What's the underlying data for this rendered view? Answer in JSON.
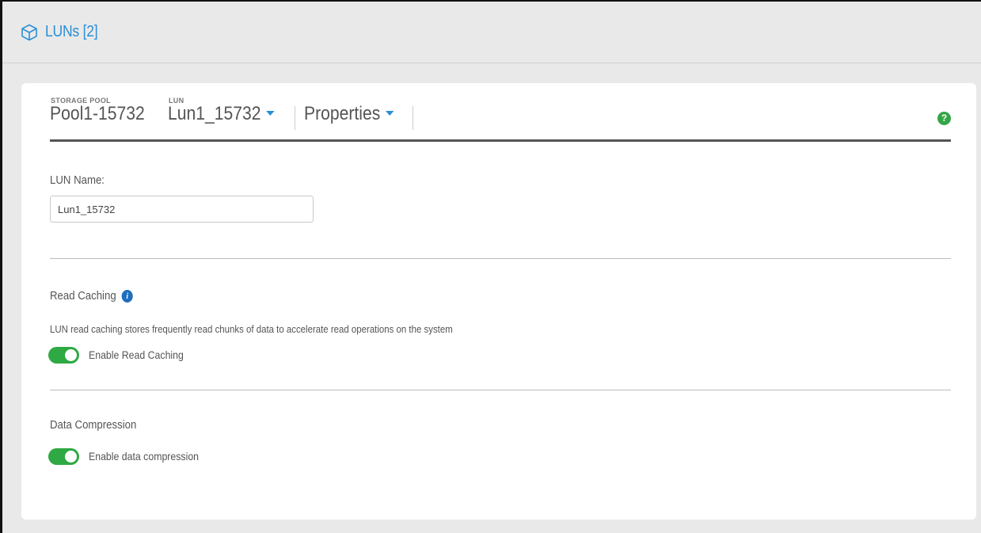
{
  "header": {
    "title": "LUNs [2]",
    "icon": "cube-icon",
    "accent_color": "#2b8fd6"
  },
  "breadcrumb": {
    "storage_pool_label": "STORAGE POOL",
    "storage_pool_value": "Pool1-15732",
    "lun_label": "LUN",
    "lun_value": "Lun1_15732",
    "view_value": "Properties",
    "help_glyph": "?"
  },
  "form": {
    "lun_name_label": "LUN Name:",
    "lun_name_value": "Lun1_15732",
    "read_caching": {
      "title": "Read Caching",
      "info_glyph": "i",
      "description": "LUN read caching stores frequently read chunks of data to accelerate read operations on the system",
      "toggle_label": "Enable Read Caching",
      "enabled": true
    },
    "data_compression": {
      "title": "Data Compression",
      "toggle_label": "Enable data compression",
      "enabled": true
    }
  },
  "colors": {
    "toggle_on": "#2fa944",
    "help": "#34a546",
    "info": "#1d6fbe"
  }
}
